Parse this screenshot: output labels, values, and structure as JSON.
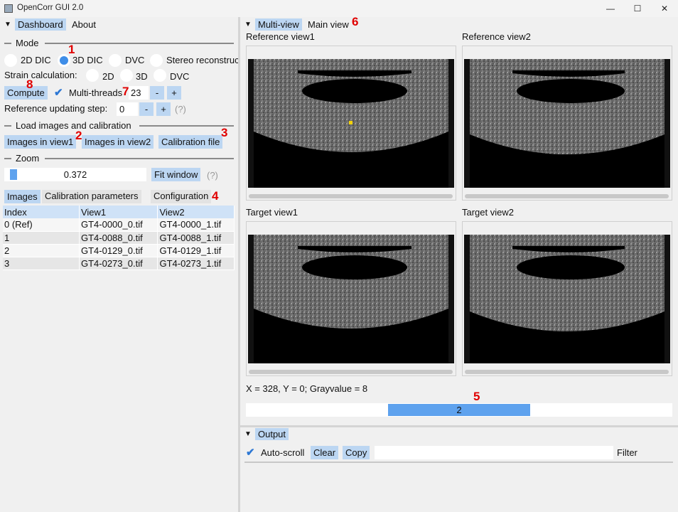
{
  "window": {
    "title": "OpenCorr GUI 2.0",
    "minimize": "—",
    "maximize": "☐",
    "close": "✕"
  },
  "left": {
    "tabs": [
      "Dashboard",
      "About"
    ],
    "mode": {
      "title": "Mode",
      "options": [
        "2D DIC",
        "3D DIC",
        "DVC",
        "Stereo reconstruct"
      ],
      "selected": "3D DIC"
    },
    "strain": {
      "label": "Strain calculation:",
      "options": [
        "2D",
        "3D",
        "DVC"
      ]
    },
    "compute": {
      "button": "Compute",
      "multithreads_label": "Multi-threads",
      "threads_value": "23",
      "minus": "-",
      "plus": "+"
    },
    "ref_update": {
      "label": "Reference updating step:",
      "value": "0",
      "minus": "-",
      "plus": "+",
      "help": "(?)"
    },
    "load": {
      "title": "Load images and calibration",
      "btn_view1": "Images in view1",
      "btn_view2": "Images in view2",
      "btn_calib": "Calibration file"
    },
    "zoom": {
      "title": "Zoom",
      "value": "0.372",
      "fit": "Fit window",
      "help": "(?)"
    },
    "subtabs": [
      "Images",
      "Calibration parameters",
      "Configuration"
    ],
    "table": {
      "headers": [
        "Index",
        "View1",
        "View2"
      ],
      "rows": [
        [
          "0 (Ref)",
          "GT4-0000_0.tif",
          "GT4-0000_1.tif"
        ],
        [
          "1",
          "GT4-0088_0.tif",
          "GT4-0088_1.tif"
        ],
        [
          "2",
          "GT4-0129_0.tif",
          "GT4-0129_1.tif"
        ],
        [
          "3",
          "GT4-0273_0.tif",
          "GT4-0273_1.tif"
        ]
      ]
    }
  },
  "right": {
    "tabs": [
      "Multi-view",
      "Main view"
    ],
    "views": [
      "Reference view1",
      "Reference view2",
      "Target view1",
      "Target view2"
    ],
    "status": "X = 328, Y = 0; Grayvalue = 8",
    "frame_value": "2"
  },
  "output": {
    "tab": "Output",
    "autoscroll": "Auto-scroll",
    "clear": "Clear",
    "copy": "Copy",
    "filter": "Filter"
  },
  "annotations": [
    "1",
    "2",
    "3",
    "4",
    "5",
    "6",
    "7",
    "8"
  ],
  "colors": {
    "accent": "#bcd6f2",
    "radio_on": "#3f8ee8",
    "slider": "#5ea2ee",
    "annotation": "#e00000"
  }
}
